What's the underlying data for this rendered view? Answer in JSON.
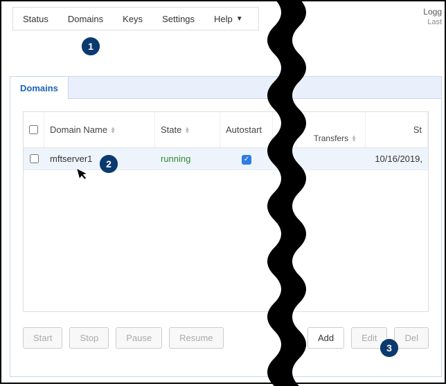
{
  "nav": {
    "status": "Status",
    "domains": "Domains",
    "keys": "Keys",
    "settings": "Settings",
    "help": "Help"
  },
  "login": {
    "line1": "Logg",
    "line2": "Last"
  },
  "tabs": {
    "domains": "Domains"
  },
  "table": {
    "headers": {
      "domain_name": "Domain Name",
      "state": "State",
      "autostart": "Autostart",
      "transfers": "Transfers",
      "start_col": "St"
    },
    "row": {
      "name": "mftserver1",
      "state": "running",
      "autostart_checked": "✓",
      "start_value": "10/16/2019,"
    }
  },
  "buttons": {
    "start": "Start",
    "stop": "Stop",
    "pause": "Pause",
    "resume": "Resume",
    "add": "Add",
    "edit": "Edit",
    "delete": "Del"
  },
  "callouts": {
    "one": "1",
    "two": "2",
    "three": "3"
  }
}
